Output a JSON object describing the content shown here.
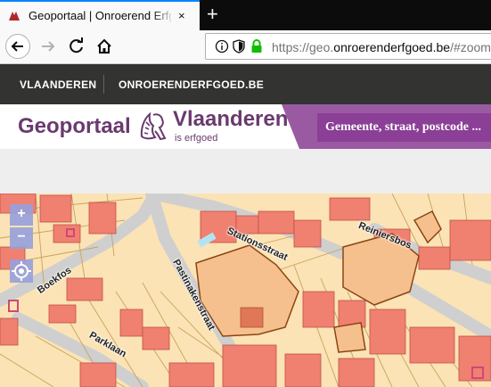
{
  "browser": {
    "tab_title": "Geoportaal | Onroerend Erfgoed",
    "tab_close": "×",
    "new_tab": "+",
    "url_prefix": "https://geo.",
    "url_domain": "onroerenderfgoed.be",
    "url_suffix": "/#zoom"
  },
  "topnav": {
    "items": [
      "VLAANDEREN",
      "ONROERENDERFGOED.BE"
    ]
  },
  "header": {
    "title": "Geoportaal",
    "brand": "Vlaanderen",
    "brand_sub": "is erfgoed",
    "search_placeholder": "Gemeente, straat, postcode ..."
  },
  "map": {
    "controls": {
      "zoom_in": "+",
      "zoom_out": "−"
    },
    "streets": [
      "Stationsstraat",
      "Reiniersbos",
      "Pastinakenstraat",
      "Boekfos",
      "Parklaan"
    ]
  },
  "colors": {
    "accent": "#8b3f96",
    "brand": "#6a3a6e",
    "topbar": "#333332",
    "parcel": "#fbe3b5",
    "building": "#f08070",
    "heritage": "#f6c08e"
  }
}
